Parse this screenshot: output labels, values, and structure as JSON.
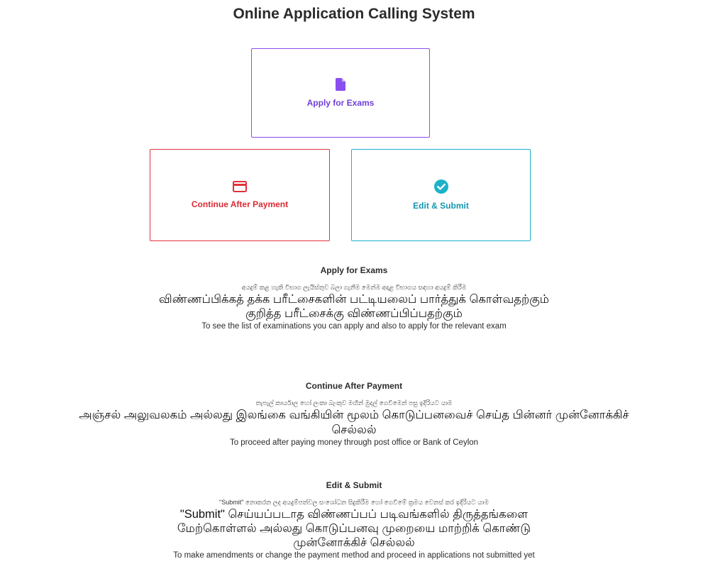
{
  "page": {
    "title": "Online Application Calling System"
  },
  "cards": {
    "apply": {
      "label": "Apply for Exams",
      "icon": "document-icon",
      "color": "#8a4df0"
    },
    "continue": {
      "label": "Continue After Payment",
      "icon": "credit-card-icon",
      "color": "#e0313c"
    },
    "edit": {
      "label": "Edit & Submit",
      "icon": "check-circle-icon",
      "color": "#1cb2c7"
    }
  },
  "descriptions": {
    "apply": {
      "heading": "Apply for Exams",
      "sinhala": "අයදුම් කළ හැකි විභාග ලැයිස්තුව බලා ගැනීම මෙන්ම අදාළ විභාගය සඳහා අයදුම් කිරීම",
      "tamil": "விண்ணப்பிக்கத் தக்க பரீட்சைகளின் பட்டியலைப் பார்த்துக் கொள்வதற்கும் குறித்த பரீட்சைக்கு விண்ணப்பிப்பதற்கும்",
      "english": "To see the list of examinations you can apply and also to apply for the relevant exam"
    },
    "continue": {
      "heading": "Continue After Payment",
      "sinhala": "තැපැල් කාර්යාල හෝ ලංකා බැංකුව මඟින් මුදල් ගෙවීමෙන් පසු ඉදිරියට යාම",
      "tamil_line1": "அஞ்சல் அலுவலகம் அல்லது இலங்கை வங்கியின் மூலம் கொடுப்பனவைச் செய்த பின்னர் முன்னோக்கிச்",
      "tamil_line2": "செல்லல்",
      "english": "To proceed after paying money through post office or Bank of Ceylon"
    },
    "edit": {
      "heading": "Edit & Submit",
      "sinhala": "\"Submit\" නොකරන ලද අයදුම්පත්වල සංශෝධන සිදුකිරීම හෝ ගෙවීමේ ක්‍රමය වෙනස් කර ඉදිරියට යාම",
      "tamil": "\"Submit\" செய்யப்படாத விண்ணப்பப் படிவங்களில் திருத்தங்களை மேற்கொள்ளல் அல்லது கொடுப்பனவு முறையை மாற்றிக் கொண்டு முன்னோக்கிச் செல்லல்",
      "english": "To make amendments or change the payment method and proceed in applications not submitted yet"
    }
  }
}
